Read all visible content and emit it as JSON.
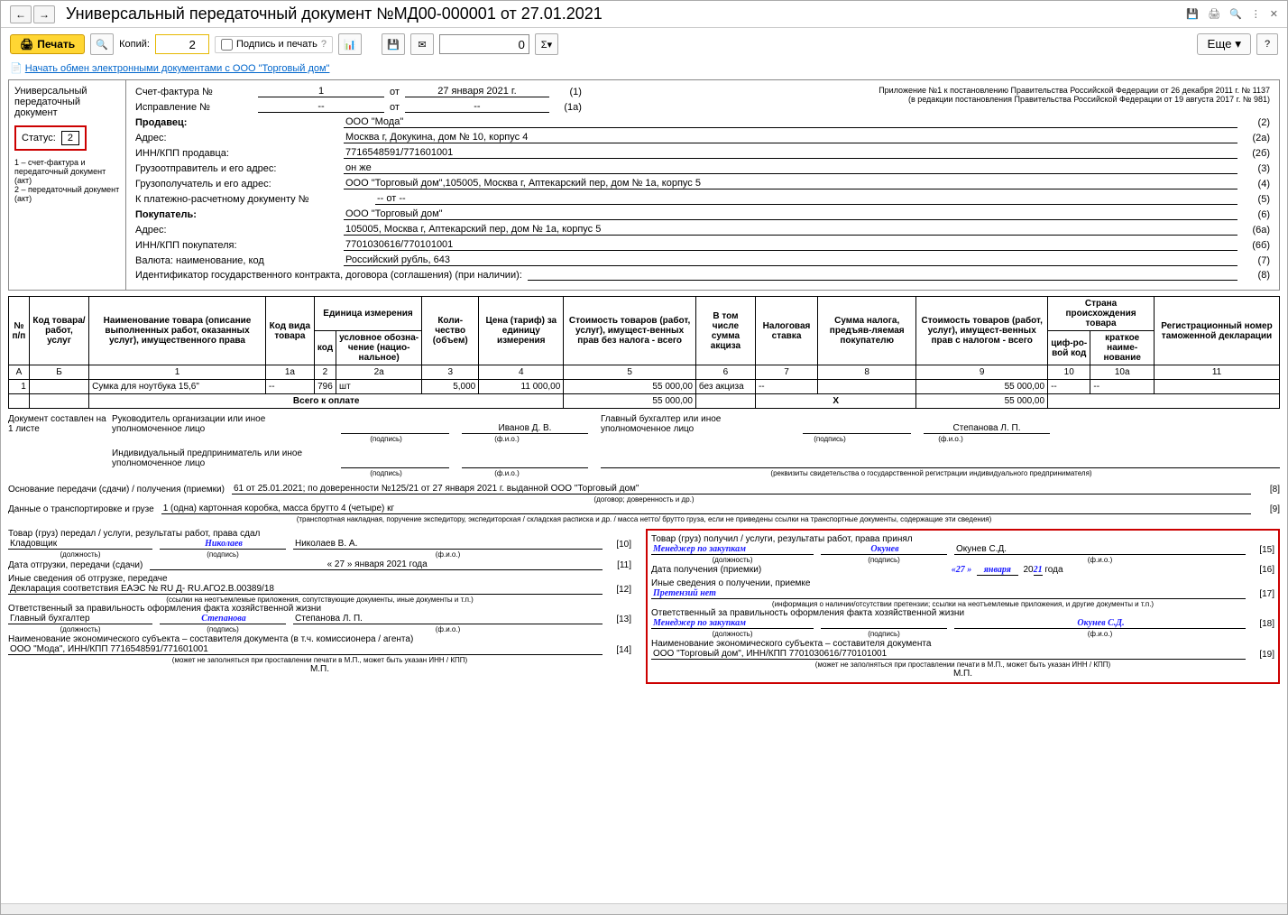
{
  "window": {
    "title": "Универсальный передаточный документ №МД00-000001 от 27.01.2021"
  },
  "toolbar": {
    "print": "Печать",
    "copies_label": "Копий:",
    "copies": "2",
    "sign_print": "Подпись и печать",
    "num": "0",
    "more": "Еще",
    "help": "?"
  },
  "link": "Начать обмен электронными документами с ООО \"Торговый дом\"",
  "left": {
    "l1": "Универсальный",
    "l2": "передаточный",
    "l3": "документ",
    "status_label": "Статус:",
    "status_val": "2",
    "foot": "1 – счет-фактура и передаточный документ (акт)\n2 – передаточный документ (акт)"
  },
  "appendix": {
    "a1": "Приложение №1 к постановлению Правительства Российской Федерации от 26 декабря 2011 г. № 1137",
    "a2": "(в редакции постановления Правительства Российской Федерации от 19 августа 2017 г. № 981)"
  },
  "hdr": {
    "sf_label": "Счет-фактура №",
    "sf_no": "1",
    "ot": "от",
    "sf_date": "27 января 2021 г.",
    "sf_p": "(1)",
    "corr_label": "Исправление №",
    "corr_no": "--",
    "corr_date": "--",
    "corr_p": "(1а)",
    "seller_lbl": "Продавец:",
    "seller": "ООО \"Мода\"",
    "p2": "(2)",
    "addr_lbl": "Адрес:",
    "seller_addr": "Москва г, Докукина, дом № 10, корпус 4",
    "p2a": "(2а)",
    "inn_lbl": "ИНН/КПП продавца:",
    "seller_inn": "7716548591/771601001",
    "p2b": "(2б)",
    "ship_lbl": "Грузоотправитель и его адрес:",
    "ship": "он же",
    "p3": "(3)",
    "cons_lbl": "Грузополучатель и его адрес:",
    "cons": "ООО \"Торговый дом\",105005, Москва г, Аптекарский пер, дом № 1а, корпус 5",
    "p4": "(4)",
    "pay_lbl": "К платежно-расчетному документу №",
    "pay": "-- от --",
    "p5": "(5)",
    "buyer_lbl": "Покупатель:",
    "buyer": "ООО \"Торговый дом\"",
    "p6": "(6)",
    "buyer_addr": "105005, Москва г, Аптекарский пер, дом № 1а, корпус 5",
    "p6a": "(6а)",
    "binn_lbl": "ИНН/КПП покупателя:",
    "binn": "7701030616/770101001",
    "p6b": "(6б)",
    "cur_lbl": "Валюта: наименование, код",
    "cur": "Российский рубль, 643",
    "p7": "(7)",
    "id_lbl": "Идентификатор государственного контракта, договора (соглашения) (при наличии):",
    "p8": "(8)"
  },
  "th": {
    "c1": "№ п/п",
    "c2": "Код товара/ работ, услуг",
    "c3": "Наименование товара (описание выполненных работ, оказанных услуг), имущественного права",
    "c4": "Код вида товара",
    "c5": "Единица измерения",
    "c5a": "код",
    "c5b": "условное обозна-чение (нацио-нальное)",
    "c6": "Коли-чество (объем)",
    "c7": "Цена (тариф) за единицу измерения",
    "c8": "Стоимость товаров (работ, услуг), имущест-венных прав без налога - всего",
    "c9": "В том числе сумма акциза",
    "c10": "Налоговая ставка",
    "c11": "Сумма налога, предъяв-ляемая покупателю",
    "c12": "Стоимость товаров (работ, услуг), имущест-венных прав с налогом - всего",
    "c13": "Страна происхождения товара",
    "c13a": "циф-ро-вой код",
    "c13b": "краткое наиме-нование",
    "c14": "Регистрационный номер таможенной декларации",
    "nA": "А",
    "nB": "Б",
    "n1": "1",
    "n1a": "1а",
    "n2": "2",
    "n2a": "2а",
    "n3": "3",
    "n4": "4",
    "n5": "5",
    "n6": "6",
    "n7": "7",
    "n8": "8",
    "n9": "9",
    "n10": "10",
    "n10a": "10а",
    "n11": "11"
  },
  "row": {
    "n": "1",
    "code": "",
    "name": "Сумка для ноутбука 15,6\"",
    "kind": "--",
    "ucode": "796",
    "uname": "шт",
    "qty": "5,000",
    "price": "11 000,00",
    "sum_no_tax": "55 000,00",
    "excise": "без акциза",
    "rate": "--",
    "tax": "",
    "sum_tax": "55 000,00",
    "ccode": "--",
    "cname": "--",
    "decl": ""
  },
  "totals": {
    "label": "Всего к оплате",
    "sum_no_tax": "55 000,00",
    "x": "Х",
    "tax": "",
    "sum_tax": "55 000,00"
  },
  "sign": {
    "doc_on": "Документ составлен на",
    "sheets": "1 листе",
    "ruk": "Руководитель организации или иное уполномоченное лицо",
    "gb": "Главный бухгалтер или иное уполномоченное лицо",
    "ip": "Индивидуальный предприниматель или иное уполномоченное лицо",
    "podpis": "(подпись)",
    "fio": "(ф.и.о.)",
    "rekv": "(реквизиты свидетельства о государственной  регистрации индивидуального предпринимателя)",
    "ivanov": "Иванов Д. В.",
    "stepanova": "Степанова Л. П."
  },
  "base": {
    "lbl": "Основание передачи (сдачи) / получения (приемки)",
    "val": "61 от 25.01.2021; по доверенности №125/21 от 27 января 2021 г. выданной ООО \"Торговый дом\"",
    "sub": "(договор; доверенность и др.)",
    "p": "[8]"
  },
  "trans": {
    "lbl": "Данные о транспортировке и грузе",
    "val": "1 (одна) картонная коробка, масса брутто 4 (четыре) кг",
    "sub": "(транспортная накладная, поручение экспедитору, экспедиторская / складская расписка и др. / масса нетто/ брутто груза, если не приведены ссылки на транспортные документы, содержащие эти сведения)",
    "p": "[9]"
  },
  "tx": {
    "h": "Товар (груз) передал / услуги, результаты работ, права сдал",
    "pos": "Кладовщик",
    "sig": "Николаев",
    "fio": "Николаев В. А.",
    "p10": "[10]",
    "date_lbl": "Дата отгрузки, передачи (сдачи)",
    "date": "« 27 »   января   2021  года",
    "p11": "[11]",
    "other_lbl": "Иные сведения об отгрузке, передаче",
    "other": "Декларация соответствия ЕАЭС № RU Д- RU.АГО2.В.00389/18",
    "p12": "[12]",
    "other_sub": "(ссылки на неотъемлемые приложения, сопутствующие документы, иные документы и т.п.)",
    "resp_lbl": "Ответственный за правильность оформления факта хозяйственной жизни",
    "resp_pos": "Главный бухгалтер",
    "resp_sig": "Степанова",
    "resp_fio": "Степанова Л. П.",
    "p13": "[13]",
    "ent_lbl": "Наименование экономического субъекта – составителя документа (в т.ч. комиссионера / агента)",
    "ent": "ООО \"Мода\", ИНН/КПП 7716548591/771601001",
    "p14": "[14]",
    "ent_sub": "(может не заполняться при проставлении печати в М.П., может быть указан ИНН / КПП)",
    "mp": "М.П.",
    "dol": "(должность)",
    "podpis": "(подпись)",
    "fio_l": "(ф.и.о.)"
  },
  "rx": {
    "h": "Товар (груз) получил / услуги, результаты работ, права принял",
    "pos": "Менеджер по закупкам",
    "sig": "Окунев",
    "fio": "Окунев С.Д.",
    "p15": "[15]",
    "date_lbl": "Дата получения (приемки)",
    "date_d": "«27 »",
    "date_m": "января",
    "date_y1": "20",
    "date_y2": "21",
    "date_g": "года",
    "p16": "[16]",
    "other_lbl": "Иные сведения о получении, приемке",
    "other": "Претензий нет",
    "p17": "[17]",
    "other_sub": "(информация о наличии/отсутствии претензии; ссылки на неотъемлемые приложения, и другие  документы и т.п.)",
    "resp_lbl": "Ответственный за правильность оформления факта хозяйственной жизни",
    "resp_pos": "Менеджер по закупкам",
    "resp_fio": "Окунев С.Д.",
    "p18": "[18]",
    "ent_lbl": "Наименование экономического субъекта – составителя документа",
    "ent": "ООО \"Торговый дом\", ИНН/КПП 7701030616/770101001",
    "p19": "[19]",
    "ent_sub": "(может не заполняться при проставлении печати в М.П., может быть указан ИНН / КПП)",
    "mp": "М.П."
  }
}
